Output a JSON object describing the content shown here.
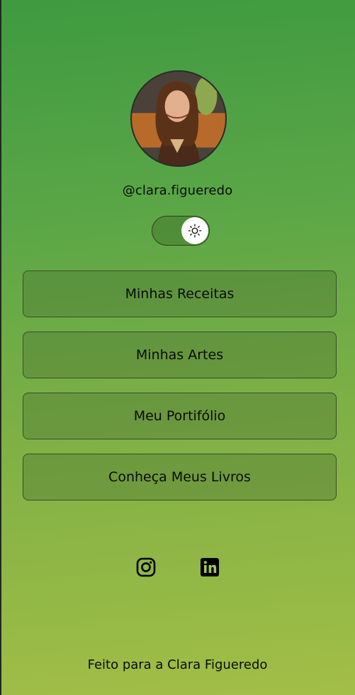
{
  "profile": {
    "username": "@clara.figueredo"
  },
  "theme_toggle": {
    "icon": "sun-icon",
    "state": "light"
  },
  "links": [
    {
      "label": "Minhas Receitas"
    },
    {
      "label": "Minhas Artes"
    },
    {
      "label": "Meu Portifólio"
    },
    {
      "label": "Conheça Meus Livros"
    }
  ],
  "social": [
    {
      "icon": "instagram-icon"
    },
    {
      "icon": "linkedin-icon"
    }
  ],
  "footer": {
    "text": "Feito para a Clara Figueredo"
  },
  "colors": {
    "gradient_top": "#3f9a40",
    "gradient_bottom": "#a3be47",
    "button_border": "#3a4e2a"
  }
}
